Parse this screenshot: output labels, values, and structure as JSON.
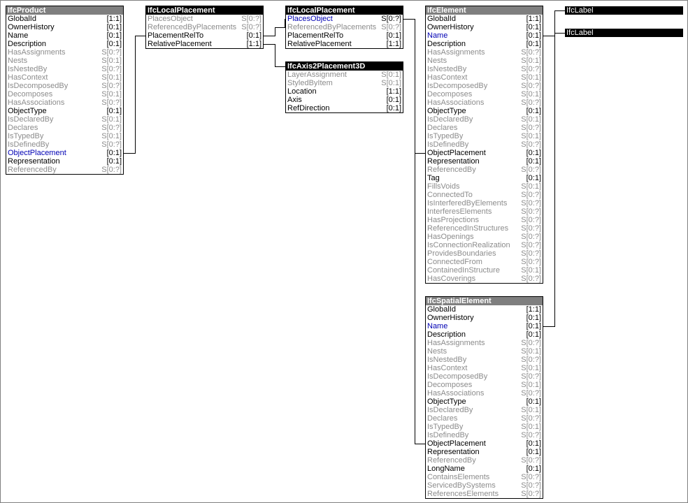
{
  "entities": {
    "ifcProduct": {
      "title": "IfcProduct",
      "attrs": [
        {
          "name": "GlobalId",
          "card": "[1:1]",
          "kind": "n"
        },
        {
          "name": "OwnerHistory",
          "card": "[0:1]",
          "kind": "n"
        },
        {
          "name": "Name",
          "card": "[0:1]",
          "kind": "n"
        },
        {
          "name": "Description",
          "card": "[0:1]",
          "kind": "n"
        },
        {
          "name": "HasAssignments",
          "card": "S[0:?]",
          "kind": "i"
        },
        {
          "name": "Nests",
          "card": "S[0:1]",
          "kind": "i"
        },
        {
          "name": "IsNestedBy",
          "card": "S[0:?]",
          "kind": "i"
        },
        {
          "name": "HasContext",
          "card": "S[0:1]",
          "kind": "i"
        },
        {
          "name": "IsDecomposedBy",
          "card": "S[0:?]",
          "kind": "i"
        },
        {
          "name": "Decomposes",
          "card": "S[0:1]",
          "kind": "i"
        },
        {
          "name": "HasAssociations",
          "card": "S[0:?]",
          "kind": "i"
        },
        {
          "name": "ObjectType",
          "card": "[0:1]",
          "kind": "n"
        },
        {
          "name": "IsDeclaredBy",
          "card": "S[0:1]",
          "kind": "i"
        },
        {
          "name": "Declares",
          "card": "S[0:?]",
          "kind": "i"
        },
        {
          "name": "IsTypedBy",
          "card": "S[0:1]",
          "kind": "i"
        },
        {
          "name": "IsDefinedBy",
          "card": "S[0:?]",
          "kind": "i"
        },
        {
          "name": "ObjectPlacement",
          "card": "[0:1]",
          "kind": "h"
        },
        {
          "name": "Representation",
          "card": "[0:1]",
          "kind": "n"
        },
        {
          "name": "ReferencedBy",
          "card": "S[0:?]",
          "kind": "i"
        }
      ]
    },
    "ifcLocalPlacement1": {
      "title": "IfcLocalPlacement",
      "attrs": [
        {
          "name": "PlacesObject",
          "card": "S[0:?]",
          "kind": "i"
        },
        {
          "name": "ReferencedByPlacements",
          "card": "S[0:?]",
          "kind": "i"
        },
        {
          "name": "PlacementRelTo",
          "card": "[0:1]",
          "kind": "n"
        },
        {
          "name": "RelativePlacement",
          "card": "[1:1]",
          "kind": "n"
        }
      ]
    },
    "ifcLocalPlacement2": {
      "title": "IfcLocalPlacement",
      "attrs": [
        {
          "name": "PlacesObject",
          "card": "S[0:?]",
          "kind": "h"
        },
        {
          "name": "ReferencedByPlacements",
          "card": "S[0:?]",
          "kind": "i"
        },
        {
          "name": "PlacementRelTo",
          "card": "[0:1]",
          "kind": "n"
        },
        {
          "name": "RelativePlacement",
          "card": "[1:1]",
          "kind": "n"
        }
      ]
    },
    "ifcAxis2Placement3D": {
      "title": "IfcAxis2Placement3D",
      "attrs": [
        {
          "name": "LayerAssignment",
          "card": "S[0:1]",
          "kind": "i"
        },
        {
          "name": "StyledByItem",
          "card": "S[0:1]",
          "kind": "i"
        },
        {
          "name": "Location",
          "card": "[1:1]",
          "kind": "n"
        },
        {
          "name": "Axis",
          "card": "[0:1]",
          "kind": "n"
        },
        {
          "name": "RefDirection",
          "card": "[0:1]",
          "kind": "n"
        }
      ]
    },
    "ifcElement": {
      "title": "IfcElement",
      "attrs": [
        {
          "name": "GlobalId",
          "card": "[1:1]",
          "kind": "n"
        },
        {
          "name": "OwnerHistory",
          "card": "[0:1]",
          "kind": "n"
        },
        {
          "name": "Name",
          "card": "[0:1]",
          "kind": "h"
        },
        {
          "name": "Description",
          "card": "[0:1]",
          "kind": "n"
        },
        {
          "name": "HasAssignments",
          "card": "S[0:?]",
          "kind": "i"
        },
        {
          "name": "Nests",
          "card": "S[0:1]",
          "kind": "i"
        },
        {
          "name": "IsNestedBy",
          "card": "S[0:?]",
          "kind": "i"
        },
        {
          "name": "HasContext",
          "card": "S[0:1]",
          "kind": "i"
        },
        {
          "name": "IsDecomposedBy",
          "card": "S[0:?]",
          "kind": "i"
        },
        {
          "name": "Decomposes",
          "card": "S[0:1]",
          "kind": "i"
        },
        {
          "name": "HasAssociations",
          "card": "S[0:?]",
          "kind": "i"
        },
        {
          "name": "ObjectType",
          "card": "[0:1]",
          "kind": "n"
        },
        {
          "name": "IsDeclaredBy",
          "card": "S[0:1]",
          "kind": "i"
        },
        {
          "name": "Declares",
          "card": "S[0:?]",
          "kind": "i"
        },
        {
          "name": "IsTypedBy",
          "card": "S[0:1]",
          "kind": "i"
        },
        {
          "name": "IsDefinedBy",
          "card": "S[0:?]",
          "kind": "i"
        },
        {
          "name": "ObjectPlacement",
          "card": "[0:1]",
          "kind": "n"
        },
        {
          "name": "Representation",
          "card": "[0:1]",
          "kind": "n"
        },
        {
          "name": "ReferencedBy",
          "card": "S[0:?]",
          "kind": "i"
        },
        {
          "name": "Tag",
          "card": "[0:1]",
          "kind": "n"
        },
        {
          "name": "FillsVoids",
          "card": "S[0:1]",
          "kind": "i"
        },
        {
          "name": "ConnectedTo",
          "card": "S[0:?]",
          "kind": "i"
        },
        {
          "name": "IsInterferedByElements",
          "card": "S[0:?]",
          "kind": "i"
        },
        {
          "name": "InterferesElements",
          "card": "S[0:?]",
          "kind": "i"
        },
        {
          "name": "HasProjections",
          "card": "S[0:?]",
          "kind": "i"
        },
        {
          "name": "ReferencedInStructures",
          "card": "S[0:?]",
          "kind": "i"
        },
        {
          "name": "HasOpenings",
          "card": "S[0:?]",
          "kind": "i"
        },
        {
          "name": "IsConnectionRealization",
          "card": "S[0:?]",
          "kind": "i"
        },
        {
          "name": "ProvidesBoundaries",
          "card": "S[0:?]",
          "kind": "i"
        },
        {
          "name": "ConnectedFrom",
          "card": "S[0:?]",
          "kind": "i"
        },
        {
          "name": "ContainedInStructure",
          "card": "S[0:1]",
          "kind": "i"
        },
        {
          "name": "HasCoverings",
          "card": "S[0:?]",
          "kind": "i"
        }
      ]
    },
    "ifcSpatialElement": {
      "title": "IfcSpatialElement",
      "attrs": [
        {
          "name": "GlobalId",
          "card": "[1:1]",
          "kind": "n"
        },
        {
          "name": "OwnerHistory",
          "card": "[0:1]",
          "kind": "n"
        },
        {
          "name": "Name",
          "card": "[0:1]",
          "kind": "h"
        },
        {
          "name": "Description",
          "card": "[0:1]",
          "kind": "n"
        },
        {
          "name": "HasAssignments",
          "card": "S[0:?]",
          "kind": "i"
        },
        {
          "name": "Nests",
          "card": "S[0:1]",
          "kind": "i"
        },
        {
          "name": "IsNestedBy",
          "card": "S[0:?]",
          "kind": "i"
        },
        {
          "name": "HasContext",
          "card": "S[0:1]",
          "kind": "i"
        },
        {
          "name": "IsDecomposedBy",
          "card": "S[0:?]",
          "kind": "i"
        },
        {
          "name": "Decomposes",
          "card": "S[0:1]",
          "kind": "i"
        },
        {
          "name": "HasAssociations",
          "card": "S[0:?]",
          "kind": "i"
        },
        {
          "name": "ObjectType",
          "card": "[0:1]",
          "kind": "n"
        },
        {
          "name": "IsDeclaredBy",
          "card": "S[0:1]",
          "kind": "i"
        },
        {
          "name": "Declares",
          "card": "S[0:?]",
          "kind": "i"
        },
        {
          "name": "IsTypedBy",
          "card": "S[0:1]",
          "kind": "i"
        },
        {
          "name": "IsDefinedBy",
          "card": "S[0:?]",
          "kind": "i"
        },
        {
          "name": "ObjectPlacement",
          "card": "[0:1]",
          "kind": "n"
        },
        {
          "name": "Representation",
          "card": "[0:1]",
          "kind": "n"
        },
        {
          "name": "ReferencedBy",
          "card": "S[0:?]",
          "kind": "i"
        },
        {
          "name": "LongName",
          "card": "[0:1]",
          "kind": "n"
        },
        {
          "name": "ContainsElements",
          "card": "S[0:?]",
          "kind": "i"
        },
        {
          "name": "ServicedBySystems",
          "card": "S[0:?]",
          "kind": "i"
        },
        {
          "name": "ReferencesElements",
          "card": "S[0:?]",
          "kind": "i"
        }
      ]
    }
  },
  "labels": [
    "IfcLabel",
    "IfcLabel"
  ],
  "colors": {
    "header_dark": "#000000",
    "header_grey": "#7f7f7f",
    "inverse_attr": "#8c8c8c",
    "highlight_attr": "#0000b4",
    "line": "#000000"
  }
}
